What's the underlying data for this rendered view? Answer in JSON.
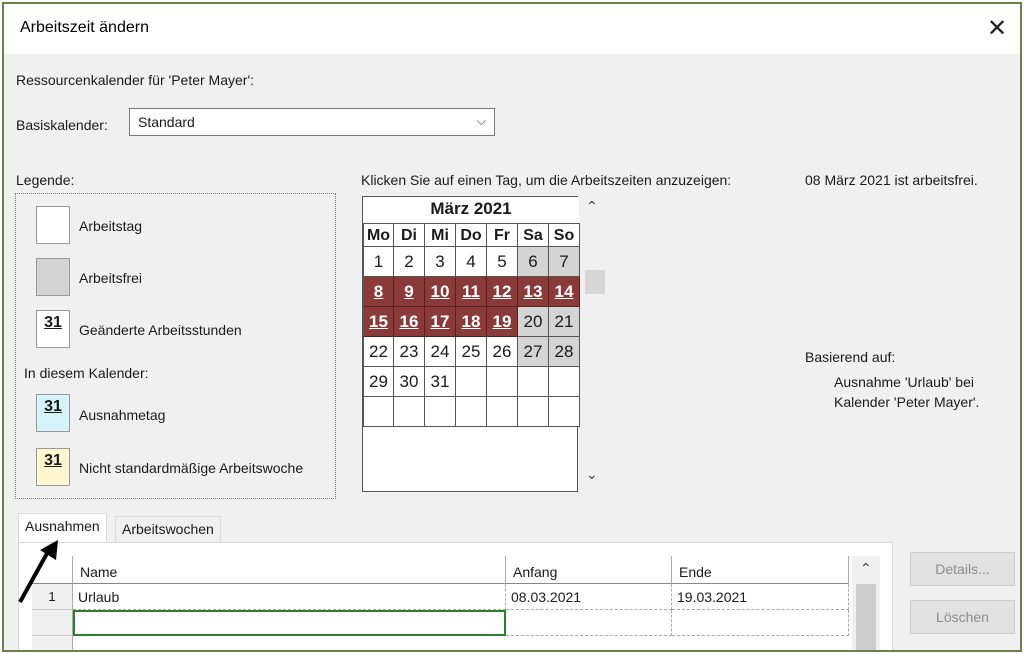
{
  "window": {
    "title": "Arbeitszeit ändern",
    "close_glyph": "✕"
  },
  "resource_label": "Ressourcenkalender für 'Peter Mayer':",
  "base_calendar": {
    "label": "Basiskalender:",
    "value": "Standard",
    "chevron": "⌵"
  },
  "legend": {
    "title": "Legende:",
    "items": [
      {
        "label": "Arbeitstag"
      },
      {
        "label": "Arbeitsfrei"
      },
      {
        "label": "Geänderte Arbeitsstunden",
        "glyph": "31"
      }
    ],
    "section": "In diesem Kalender:",
    "calendar_items": [
      {
        "label": "Ausnahmetag",
        "glyph": "31",
        "color": "#d4f4fa"
      },
      {
        "label": "Nicht standardmäßige Arbeitswoche",
        "glyph": "31",
        "color": "#fef6cf"
      }
    ]
  },
  "instruction": "Klicken Sie auf einen Tag, um die Arbeitszeiten anzuzeigen:",
  "selected_info": "08 März 2021 ist arbeitsfrei.",
  "calendar": {
    "month": "März 2021",
    "weekdays": [
      "Mo",
      "Di",
      "Mi",
      "Do",
      "Fr",
      "Sa",
      "So"
    ],
    "weeks": [
      [
        {
          "d": "1",
          "s": "w"
        },
        {
          "d": "2",
          "s": "w"
        },
        {
          "d": "3",
          "s": "w"
        },
        {
          "d": "4",
          "s": "w"
        },
        {
          "d": "5",
          "s": "w"
        },
        {
          "d": "6",
          "s": "o"
        },
        {
          "d": "7",
          "s": "o"
        }
      ],
      [
        {
          "d": "8",
          "s": "e"
        },
        {
          "d": "9",
          "s": "e"
        },
        {
          "d": "10",
          "s": "e"
        },
        {
          "d": "11",
          "s": "e"
        },
        {
          "d": "12",
          "s": "e"
        },
        {
          "d": "13",
          "s": "e"
        },
        {
          "d": "14",
          "s": "e"
        }
      ],
      [
        {
          "d": "15",
          "s": "e"
        },
        {
          "d": "16",
          "s": "e"
        },
        {
          "d": "17",
          "s": "e"
        },
        {
          "d": "18",
          "s": "e"
        },
        {
          "d": "19",
          "s": "e"
        },
        {
          "d": "20",
          "s": "o"
        },
        {
          "d": "21",
          "s": "o"
        }
      ],
      [
        {
          "d": "22",
          "s": "w"
        },
        {
          "d": "23",
          "s": "w"
        },
        {
          "d": "24",
          "s": "w"
        },
        {
          "d": "25",
          "s": "w"
        },
        {
          "d": "26",
          "s": "w"
        },
        {
          "d": "27",
          "s": "o"
        },
        {
          "d": "28",
          "s": "o"
        }
      ],
      [
        {
          "d": "29",
          "s": "w"
        },
        {
          "d": "30",
          "s": "w"
        },
        {
          "d": "31",
          "s": "w"
        },
        {
          "d": "",
          "s": "w"
        },
        {
          "d": "",
          "s": "w"
        },
        {
          "d": "",
          "s": "w"
        },
        {
          "d": "",
          "s": "w"
        }
      ],
      [
        {
          "d": "",
          "s": "w"
        },
        {
          "d": "",
          "s": "w"
        },
        {
          "d": "",
          "s": "w"
        },
        {
          "d": "",
          "s": "w"
        },
        {
          "d": "",
          "s": "w"
        },
        {
          "d": "",
          "s": "w"
        },
        {
          "d": "",
          "s": "w"
        }
      ]
    ],
    "scroll_up": "⌃",
    "scroll_down": "⌄"
  },
  "based_on": {
    "label": "Basierend auf:",
    "line1": "Ausnahme 'Urlaub' bei",
    "line2": "Kalender 'Peter Mayer'."
  },
  "tabs": [
    {
      "label": "Ausnahmen"
    },
    {
      "label": "Arbeitswochen"
    }
  ],
  "table": {
    "columns": [
      "Name",
      "Anfang",
      "Ende"
    ],
    "rows": [
      {
        "num": "1",
        "name": "Urlaub",
        "start": "08.03.2021",
        "end": "19.03.2021"
      }
    ]
  },
  "buttons": {
    "details": "Details...",
    "delete": "Löschen"
  },
  "colors": {
    "exception": "#8b3a3a",
    "nonworking": "#d4d4d4",
    "selected_row_border": "#2e7d32"
  }
}
